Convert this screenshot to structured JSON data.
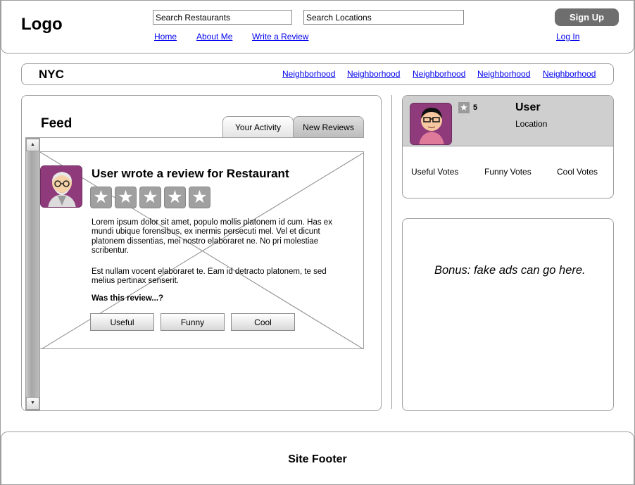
{
  "header": {
    "logo": "Logo",
    "search_restaurants": "Search Restaurants",
    "search_locations": "Search Locations",
    "nav": {
      "home": "Home",
      "about": "About Me",
      "write_review": "Write a Review"
    },
    "signup": "Sign Up",
    "login": "Log In"
  },
  "city_bar": {
    "city": "NYC",
    "neighborhoods": [
      "Neighborhood",
      "Neighborhood",
      "Neighborhood",
      "Neighborhood",
      "Neighborhood"
    ]
  },
  "feed": {
    "title": "Feed",
    "tabs": [
      {
        "label": "Your Activity"
      },
      {
        "label": "New Reviews",
        "selected": true
      }
    ],
    "review": {
      "heading": "User wrote a review for Restaurant",
      "rating": 5,
      "paragraph1": "Lorem ipsum dolor sit amet, populo mollis platonem id cum. Has ex mundi ubique forensibus, ex inermis persecuti mel. Vel et dicunt platonem dissentias, mei nostro elaboraret ne. No pri molestiae scribentur.",
      "paragraph2": "Est nullam vocent elaboraret te. Eam id detracto platonem, te sed melius pertinax senserit.",
      "prompt": "Was this review...?",
      "buttons": {
        "useful": "Useful",
        "funny": "Funny",
        "cool": "Cool"
      }
    }
  },
  "user_panel": {
    "review_count": "5",
    "name": "User",
    "location": "Location",
    "votes": {
      "useful": "Useful Votes",
      "funny": "Funny Votes",
      "cool": "Cool Votes"
    }
  },
  "ad": {
    "text": "Bonus: fake ads can go here."
  },
  "footer": {
    "text": "Site Footer"
  },
  "colors": {
    "avatar_bg": "#8f3b7b",
    "signup_bg": "#6e6e6e",
    "link": "#0000ee",
    "panel_border": "#9e9e9e"
  },
  "icons": {
    "star": "star-icon",
    "scroll_up": "arrow-up-icon",
    "scroll_down": "arrow-down-icon"
  }
}
